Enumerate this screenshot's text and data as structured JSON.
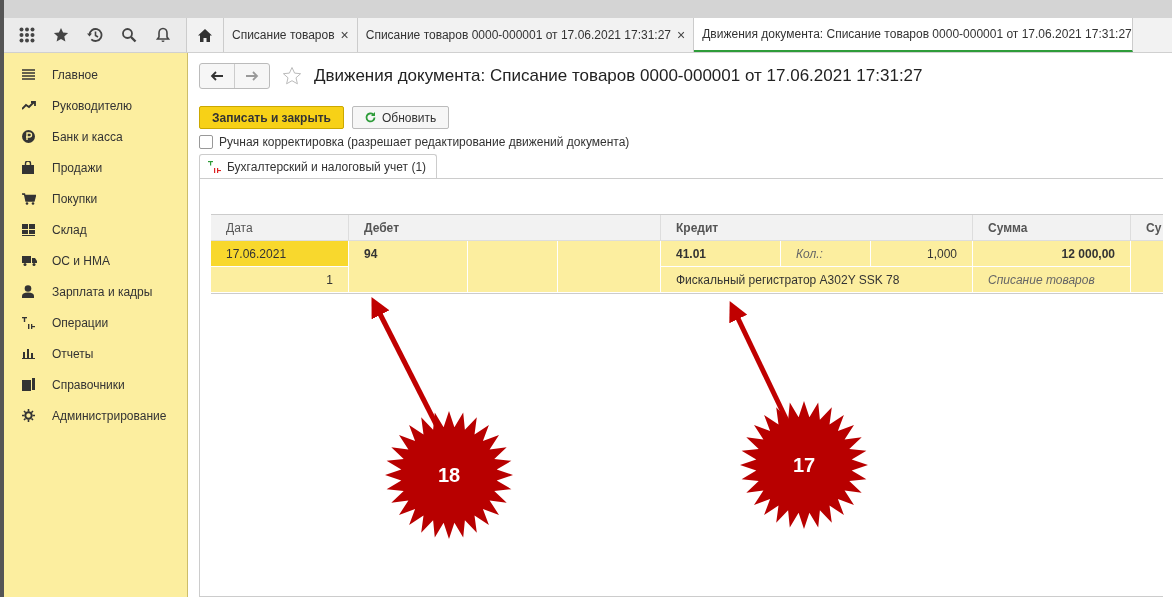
{
  "tabs": [
    {
      "label": "Списание товаров",
      "closable": true,
      "selected": false
    },
    {
      "label": "Списание товаров 0000-000001 от 17.06.2021 17:31:27",
      "closable": true,
      "selected": false
    },
    {
      "label": "Движения документа: Списание товаров 0000-000001 от 17.06.2021 17:31:27",
      "closable": false,
      "selected": true
    }
  ],
  "close_glyph": "×",
  "sidebar": {
    "items": [
      {
        "label": "Главное"
      },
      {
        "label": "Руководителю"
      },
      {
        "label": "Банк и касса"
      },
      {
        "label": "Продажи"
      },
      {
        "label": "Покупки"
      },
      {
        "label": "Склад"
      },
      {
        "label": "ОС и НМА"
      },
      {
        "label": "Зарплата и кадры"
      },
      {
        "label": "Операции"
      },
      {
        "label": "Отчеты"
      },
      {
        "label": "Справочники"
      },
      {
        "label": "Администрирование"
      }
    ]
  },
  "page": {
    "title": "Движения документа: Списание товаров 0000-000001 от 17.06.2021 17:31:27",
    "favorite": false
  },
  "buttons": [
    {
      "label": "Записать и закрыть",
      "kind": "primary"
    },
    {
      "label": "Обновить",
      "kind": "refresh"
    }
  ],
  "manual_edit": {
    "label": "Ручная корректировка (разрешает редактирование движений документа)",
    "checked": false
  },
  "register_tabs": [
    {
      "label": "Бухгалтерский и налоговый учет (1)",
      "selected": true
    }
  ],
  "table": {
    "columns": [
      "Дата",
      "Дебет",
      "Кредит",
      "Сумма",
      "Су"
    ],
    "rows": [
      {
        "selected": true,
        "date": "17.06.2021",
        "date_active": true,
        "number": "1",
        "debit_account": "94",
        "credit_account": "41.01",
        "qty_label": "Кол.:",
        "qty": "1,000",
        "credit_subconto": "Фискальный регистратор A302Y SSK 78",
        "amount": "12 000,00",
        "content": "Списание товаров"
      }
    ]
  },
  "annotations": [
    {
      "label": "18"
    },
    {
      "label": "17"
    }
  ]
}
